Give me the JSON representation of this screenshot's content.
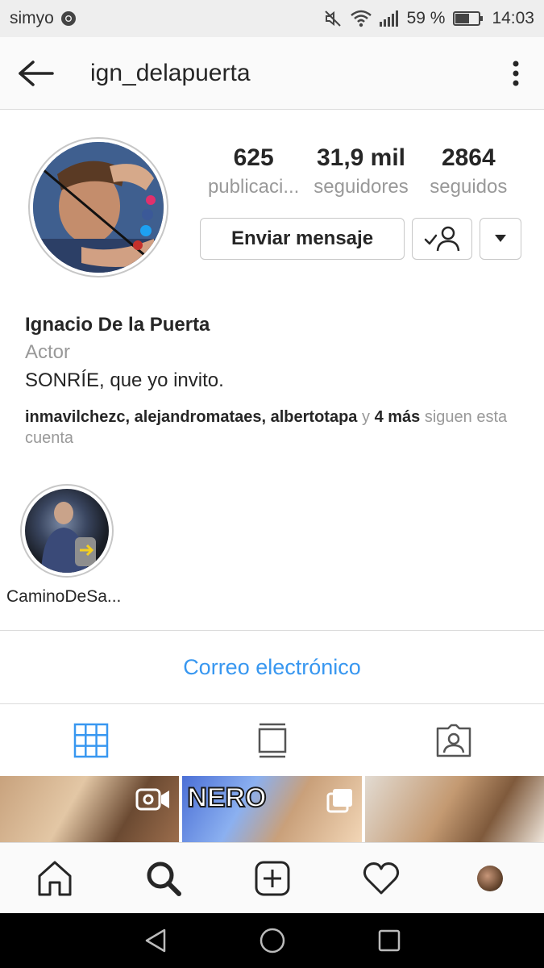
{
  "status_bar": {
    "carrier": "simyo",
    "battery": "59 %",
    "time": "14:03",
    "icons": [
      "chrome-icon",
      "mute-icon",
      "wifi-icon",
      "signal-icon",
      "battery-icon"
    ]
  },
  "header": {
    "username": "ign_delapuerta",
    "back_icon": "arrow-left-icon",
    "more_icon": "vertical-dots-icon"
  },
  "profile": {
    "stats": [
      {
        "value": "625",
        "label": "publicaci..."
      },
      {
        "value": "31,9 mil",
        "label": "seguidores"
      },
      {
        "value": "2864",
        "label": "seguidos"
      }
    ],
    "message_button": "Enviar mensaje",
    "following_icon": "person-check-icon",
    "dropdown_icon": "triangle-down-icon"
  },
  "bio": {
    "name": "Ignacio De la Puerta",
    "category": "Actor",
    "text": "SONRÍE, que yo invito.",
    "followed_by": {
      "users": [
        "inmavilchezc",
        "alejandromataes",
        "albertotapa"
      ],
      "separator": ", ",
      "connector": " y ",
      "more": "4 más",
      "suffix": " siguen esta cuenta"
    }
  },
  "highlights": [
    {
      "label": "CaminoDeSa..."
    }
  ],
  "contact": {
    "email_label": "Correo electrónico"
  },
  "tabs": [
    {
      "icon": "grid-icon",
      "active": true
    },
    {
      "icon": "feed-icon",
      "active": false
    },
    {
      "icon": "tagged-icon",
      "active": false
    }
  ],
  "posts": [
    {
      "badge_icon": "video-icon",
      "text": ""
    },
    {
      "badge_icon": "multi-image-icon",
      "text": "NERO"
    },
    {
      "badge_icon": "",
      "text": ""
    }
  ],
  "bottom_nav": [
    "home-icon",
    "search-icon",
    "add-post-icon",
    "activity-heart-icon",
    "profile-avatar"
  ],
  "android_nav": [
    "back-triangle-icon",
    "home-circle-icon",
    "recents-square-icon"
  ],
  "colors": {
    "link_blue": "#3897f0",
    "secondary_text": "#999999",
    "primary_text": "#262626",
    "border": "#dbdbdb"
  }
}
